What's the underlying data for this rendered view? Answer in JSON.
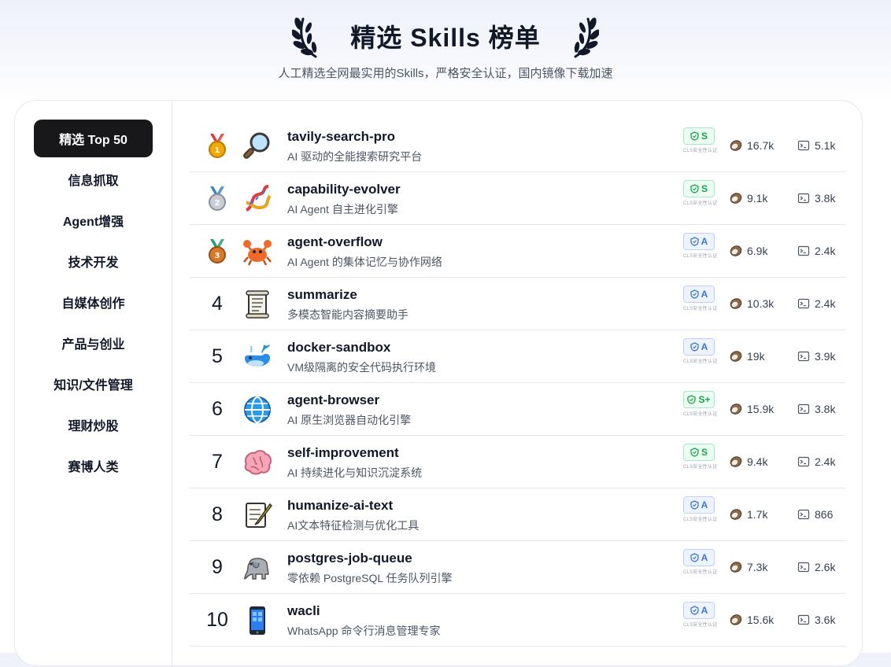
{
  "header": {
    "title": "精选 Skills 榜单",
    "subtitle": "人工精选全网最实用的Skills，严格安全认证，国内镜像下载加速"
  },
  "sidebar": {
    "items": [
      {
        "label": "精选 Top 50",
        "active": true
      },
      {
        "label": "信息抓取"
      },
      {
        "label": "Agent增强"
      },
      {
        "label": "技术开发"
      },
      {
        "label": "自媒体创作"
      },
      {
        "label": "产品与创业"
      },
      {
        "label": "知识/文件管理"
      },
      {
        "label": "理财炒股"
      },
      {
        "label": "赛博人类"
      }
    ]
  },
  "badge_note": "CLS安全性认证",
  "skills": [
    {
      "rank": "1",
      "medal": "gold",
      "icon": "magnifier-icon",
      "name": "tavily-search-pro",
      "desc": "AI 驱动的全能搜索研究平台",
      "grade": "S",
      "grade_color": "green",
      "downloads": "16.7k",
      "installs": "5.1k"
    },
    {
      "rank": "2",
      "medal": "silver",
      "icon": "dna-icon",
      "name": "capability-evolver",
      "desc": "AI Agent 自主进化引擎",
      "grade": "S",
      "grade_color": "green",
      "downloads": "9.1k",
      "installs": "3.8k"
    },
    {
      "rank": "3",
      "medal": "bronze",
      "icon": "crab-icon",
      "name": "agent-overflow",
      "desc": "AI Agent 的集体记忆与协作网络",
      "grade": "A",
      "grade_color": "blue",
      "downloads": "6.9k",
      "installs": "2.4k"
    },
    {
      "rank": "4",
      "medal": "",
      "icon": "scroll-icon",
      "name": "summarize",
      "desc": "多模态智能内容摘要助手",
      "grade": "A",
      "grade_color": "blue",
      "downloads": "10.3k",
      "installs": "2.4k"
    },
    {
      "rank": "5",
      "medal": "",
      "icon": "whale-icon",
      "name": "docker-sandbox",
      "desc": "VM级隔离的安全代码执行环境",
      "grade": "A",
      "grade_color": "blue",
      "downloads": "19k",
      "installs": "3.9k"
    },
    {
      "rank": "6",
      "medal": "",
      "icon": "globe-icon",
      "name": "agent-browser",
      "desc": "AI 原生浏览器自动化引擎",
      "grade": "S+",
      "grade_color": "green",
      "downloads": "15.9k",
      "installs": "3.8k"
    },
    {
      "rank": "7",
      "medal": "",
      "icon": "brain-icon",
      "name": "self-improvement",
      "desc": "AI 持续进化与知识沉淀系统",
      "grade": "S",
      "grade_color": "green",
      "downloads": "9.4k",
      "installs": "2.4k"
    },
    {
      "rank": "8",
      "medal": "",
      "icon": "memo-icon",
      "name": "humanize-ai-text",
      "desc": "AI文本特征检测与优化工具",
      "grade": "A",
      "grade_color": "blue",
      "downloads": "1.7k",
      "installs": "866"
    },
    {
      "rank": "9",
      "medal": "",
      "icon": "elephant-icon",
      "name": "postgres-job-queue",
      "desc": "零依赖 PostgreSQL 任务队列引擎",
      "grade": "A",
      "grade_color": "blue",
      "downloads": "7.3k",
      "installs": "2.6k"
    },
    {
      "rank": "10",
      "medal": "",
      "icon": "phone-icon",
      "name": "wacli",
      "desc": "WhatsApp 命令行消息管理专家",
      "grade": "A",
      "grade_color": "blue",
      "downloads": "15.6k",
      "installs": "3.6k"
    }
  ]
}
